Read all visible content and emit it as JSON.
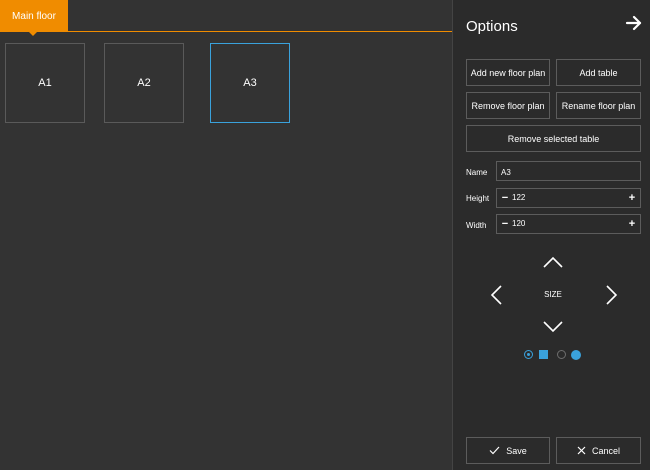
{
  "floor_tabs": [
    {
      "label": "Main floor",
      "active": true
    }
  ],
  "tables": [
    {
      "label": "A1",
      "selected": false
    },
    {
      "label": "A2",
      "selected": false
    },
    {
      "label": "A3",
      "selected": true
    }
  ],
  "options": {
    "title": "Options",
    "close_icon": "arrow-right-icon",
    "buttons": {
      "add_floor_plan": "Add new floor plan",
      "add_table": "Add table",
      "remove_floor_plan": "Remove floor plan",
      "rename_floor_plan": "Rename floor plan",
      "remove_selected_table": "Remove selected table"
    },
    "fields": {
      "name_label": "Name",
      "name_value": "A3",
      "height_label": "Height",
      "height_value": "122",
      "width_label": "Width",
      "width_value": "120",
      "minus_glyph": "−",
      "plus_glyph": "+"
    },
    "size_control": {
      "label": "SIZE"
    },
    "shape": {
      "selected": "square",
      "options": [
        "square",
        "circle"
      ]
    },
    "save_label": "Save",
    "cancel_label": "Cancel"
  },
  "colors": {
    "accent_orange": "#f08c00",
    "accent_blue": "#3aa2dc",
    "background": "#333333",
    "panel_background": "#2b2b2b"
  }
}
